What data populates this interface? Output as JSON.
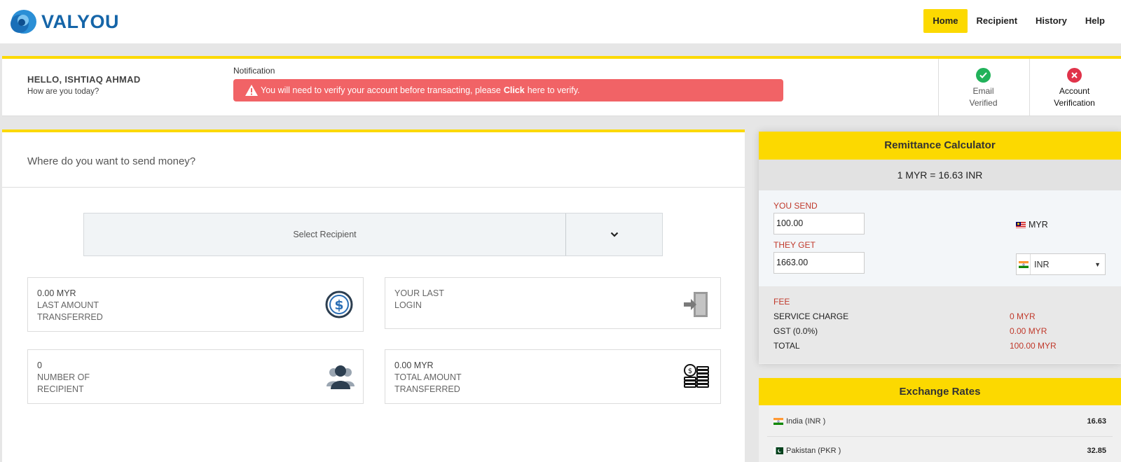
{
  "brand": {
    "name": "VALYOU",
    "color": "#1565a8",
    "accent": "#fcd900"
  },
  "nav": [
    {
      "label": "Home",
      "active": true
    },
    {
      "label": "Recipient",
      "active": false
    },
    {
      "label": "History",
      "active": false
    },
    {
      "label": "Help",
      "active": false
    }
  ],
  "greeting": {
    "name": "HELLO, ISHTIAQ AHMAD",
    "sub": "How are you today?"
  },
  "notification": {
    "title": "Notification",
    "pre": "You will need to verify your account before transacting, please",
    "link": "Click",
    "post": "here to verify."
  },
  "verification": {
    "email": {
      "line1": "Email",
      "line2": "Verified",
      "status": "ok",
      "icon": "check-circle-icon"
    },
    "account": {
      "line1": "Account",
      "line2": "Verification",
      "status": "fail",
      "icon": "x-circle-icon"
    }
  },
  "main": {
    "question": "Where do you want to send money?",
    "select_recipient": "Select Recipient",
    "stats": [
      {
        "line1": "0.00 MYR",
        "line2": "LAST AMOUNT",
        "line3": "TRANSFERRED",
        "icon": "dollar-coin-icon"
      },
      {
        "line1": "YOUR LAST",
        "line2": "LOGIN",
        "line3": "",
        "icon": "door-login-icon"
      },
      {
        "line1": "0",
        "line2": "NUMBER OF",
        "line3": "RECIPIENT",
        "icon": "users-icon"
      },
      {
        "line1": "0.00 MYR",
        "line2": "TOTAL AMOUNT",
        "line3": "TRANSFERRED",
        "icon": "coin-stack-icon"
      }
    ]
  },
  "calculator": {
    "title": "Remittance Calculator",
    "rate": "1 MYR = 16.63 INR",
    "you_send_label": "YOU SEND",
    "you_send_value": "100.00",
    "you_send_ccy": "MYR",
    "they_get_label": "THEY GET",
    "they_get_value": "1663.00",
    "they_get_ccy": "INR",
    "fee": {
      "title": "FEE",
      "rows": [
        {
          "label": "SERVICE CHARGE",
          "value": "0 MYR"
        },
        {
          "label": "GST (0.0%)",
          "value": "0.00 MYR"
        },
        {
          "label": "TOTAL",
          "value": "100.00 MYR"
        }
      ]
    }
  },
  "exchange_rates": {
    "title": "Exchange Rates",
    "rows": [
      {
        "country": "India (INR )",
        "rate": "16.63"
      },
      {
        "country": "Pakistan (PKR )",
        "rate": "32.85"
      }
    ]
  }
}
